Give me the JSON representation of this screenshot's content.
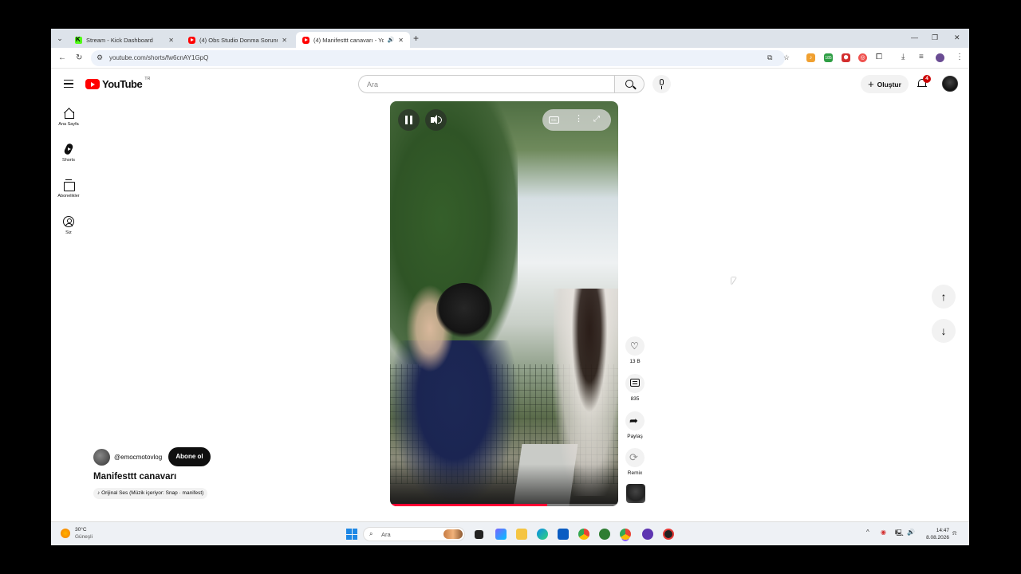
{
  "browser": {
    "tabs": [
      {
        "title": "Stream - Kick Dashboard",
        "favicon": "kick-icon",
        "active": false
      },
      {
        "title": "(4) Obs Studio Donma Sorunu",
        "favicon": "youtube-icon",
        "active": false
      },
      {
        "title": "(4) Manifesttt canavarı - Yo",
        "favicon": "youtube-icon",
        "active": true,
        "audio": true
      }
    ],
    "url": "youtube.com/shorts/fw6cnAY1GpQ",
    "extension_badge": "185"
  },
  "youtube": {
    "logo_text": "YouTube",
    "country_code": "TR",
    "search_placeholder": "Ara",
    "create_label": "Oluştur",
    "notification_count": "4",
    "sidebar": [
      {
        "label": "Ana Sayfa",
        "icon": "home-icon"
      },
      {
        "label": "Shorts",
        "icon": "shorts-icon"
      },
      {
        "label": "Abonelikler",
        "icon": "subscriptions-icon"
      },
      {
        "label": "Siz",
        "icon": "you-icon"
      }
    ],
    "short": {
      "channel": "@emocmotovlog",
      "subscribe_label": "Abone ol",
      "title": "Manifesttt canavarı",
      "audio": "Orijinal Ses (Müzik içeriyor: Snap · manifest)",
      "progress": 0.69,
      "actions": {
        "likes": "13 B",
        "comments": "835",
        "share": "Paylaş",
        "remix": "Remix"
      }
    }
  },
  "taskbar": {
    "temperature": "30°C",
    "weather": "Güneşli",
    "search_placeholder": "Ara",
    "time": "14:47",
    "date": "8.08.2026"
  },
  "colors": {
    "youtube_red": "#ff0000",
    "progress_red": "#ff0033",
    "subscribe_bg": "#0f0f0f",
    "tabstrip_bg": "#dde3ea"
  }
}
